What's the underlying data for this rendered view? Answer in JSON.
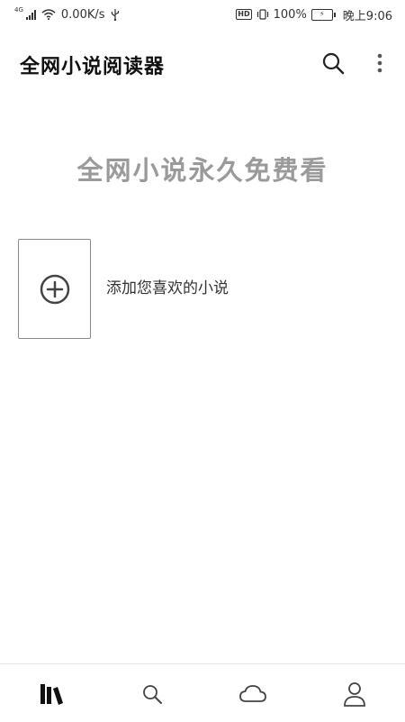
{
  "status_bar": {
    "network_type": "4G",
    "speed": "0.00K/s",
    "usb_icon": "usb-icon",
    "hd_badge": "HD",
    "battery_percent": "100%",
    "time": "晚上9:06"
  },
  "app_bar": {
    "title": "全网小说阅读器",
    "search_icon": "search-icon",
    "more_icon": "more-vertical-icon"
  },
  "main": {
    "slogan": "全网小说永久免费看",
    "add_card": {
      "icon": "add-circle-icon",
      "label": "添加您喜欢的小说"
    }
  },
  "bottom_nav": {
    "items": [
      {
        "icon": "bookshelf-icon",
        "active": true
      },
      {
        "icon": "search-icon",
        "active": false
      },
      {
        "icon": "cloud-icon",
        "active": false
      },
      {
        "icon": "user-icon",
        "active": false
      }
    ]
  },
  "colors": {
    "background": "#ffffff",
    "slogan": "#9a9a9a",
    "text": "#333333",
    "title": "#111111"
  }
}
